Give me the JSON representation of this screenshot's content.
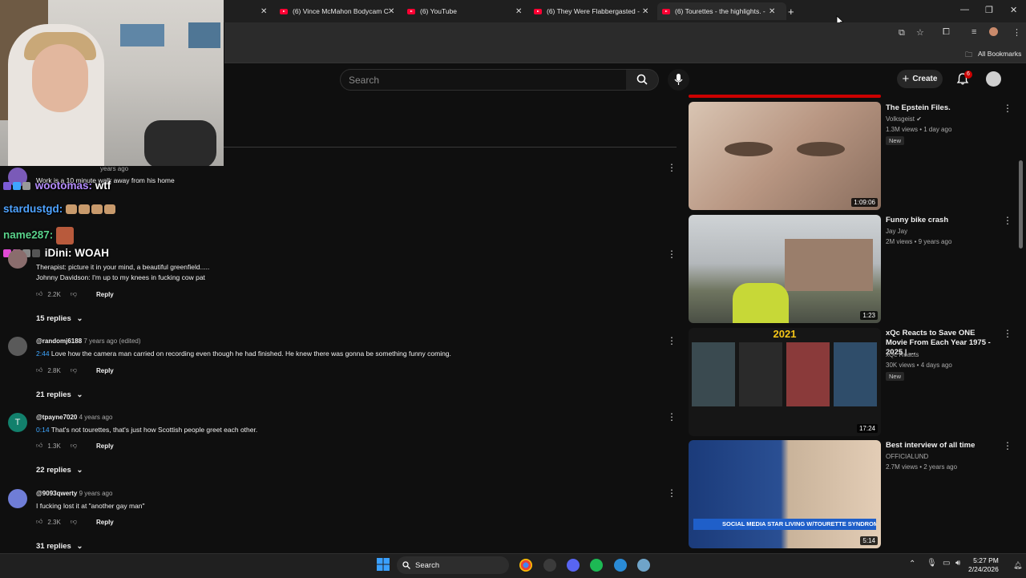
{
  "browser": {
    "tabs": [
      {
        "label": "(6) Vince McMahon Bodycam C"
      },
      {
        "label": "(6) YouTube"
      },
      {
        "label": "(6) They Were Flabbergasted - "
      },
      {
        "label": "(6) Tourettes - the highlights. -"
      }
    ],
    "bookmarks_label": "All Bookmarks"
  },
  "header": {
    "search_placeholder": "Search",
    "create_label": "Create",
    "notifications_count": "6"
  },
  "chat": [
    {
      "user": "wootomas:",
      "msg": "wtf",
      "color": "#b48cff"
    },
    {
      "user": "stardustgd:",
      "msg": "",
      "color": "#4fa3ff"
    },
    {
      "user": "name287:",
      "msg": "",
      "color": "#59d18a"
    },
    {
      "user": "iDini:",
      "msg": "WOAH",
      "color": "#ffffff"
    }
  ],
  "comments": [
    {
      "handle": "",
      "when": "years ago",
      "text_lines": [
        "Work is a 10 minute walk away from his home"
      ],
      "likes": "",
      "replies": ""
    },
    {
      "handle": "",
      "when": "",
      "text_lines": [
        "Therapist: picture it in your mind, a beautiful greenfield.....",
        "Johnny Davidson: I'm up to my knees in fucking cow pat"
      ],
      "likes": "2.2K",
      "reply_label": "Reply",
      "replies": "15 replies"
    },
    {
      "handle": "@randomj6188",
      "when": "7 years ago (edited)",
      "timestamp": "2:44",
      "text_lines": [
        "Love how the camera man carried on recording even though he had finished. He knew there was gonna be something funny coming."
      ],
      "likes": "2.8K",
      "reply_label": "Reply",
      "replies": "21 replies"
    },
    {
      "handle": "@tpayne7020",
      "when": "4 years ago",
      "timestamp": "0:14",
      "text_lines": [
        "That's not tourettes, that's just how Scottish people greet each other."
      ],
      "likes": "1.3K",
      "reply_label": "Reply",
      "replies": "22 replies",
      "avatar_letter": "T"
    },
    {
      "handle": "@9093qwerty",
      "when": "9 years ago",
      "text_lines": [
        "I fucking lost it at \"another gay man\""
      ],
      "likes": "2.3K",
      "reply_label": "Reply",
      "replies": "31 replies"
    }
  ],
  "videos": [
    {
      "title": "The Epstein Files.",
      "channel": "Volksgeist",
      "meta": "1.3M views • 1 day ago",
      "badge": "New",
      "duration": "1:09:06"
    },
    {
      "title": "Funny bike crash",
      "channel": "Jay Jay",
      "meta": "2M views • 9 years ago",
      "badge": "",
      "duration": "1:23"
    },
    {
      "title": "xQc Reacts to Save ONE Movie From Each Year 1975 - 2025 | ...",
      "channel": "xQc Reacts",
      "meta": "30K views • 4 days ago",
      "badge": "New",
      "duration": "17:24",
      "thumb_text": "2021"
    },
    {
      "title": "Best interview of all time",
      "channel": "OFFICIALUND",
      "meta": "2.7M views • 2 years ago",
      "badge": "",
      "duration": "5:14",
      "thumb_caption": "SOCIAL MEDIA STAR LIVING W/TOURETTE SYNDROME"
    }
  ],
  "taskbar": {
    "search_label": "Search",
    "time": "5:27 PM",
    "date": "2/24/2026"
  }
}
